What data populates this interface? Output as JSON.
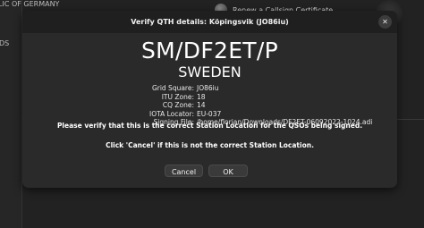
{
  "background": {
    "sidebar_top_text": "LIC OF GERMANY",
    "sidebar_mid_text": "DS",
    "menu_item_label": "Renew a Callsign Certificate"
  },
  "dialog": {
    "title": "Verify QTH details: Köpingsvik (JO86iu)",
    "close_glyph": "✕",
    "callsign": "SM/DF2ET/P",
    "country": "SWEDEN",
    "details": [
      {
        "label": "Grid Square:",
        "value": "JO86iu"
      },
      {
        "label": "ITU Zone:",
        "value": "18"
      },
      {
        "label": "CQ Zone:",
        "value": "14"
      },
      {
        "label": "IOTA Locator:",
        "value": "EU-037"
      },
      {
        "label": "Signing File:",
        "value": "/home/florian/Downloads/DF2ET-06092022-1024.adi"
      }
    ],
    "verify_message": "Please verify that this is the correct Station Location for the QSOs being signed.",
    "cancel_message": "Click 'Cancel' if this is not the correct Station Location.",
    "buttons": {
      "cancel": "Cancel",
      "ok": "OK"
    }
  }
}
